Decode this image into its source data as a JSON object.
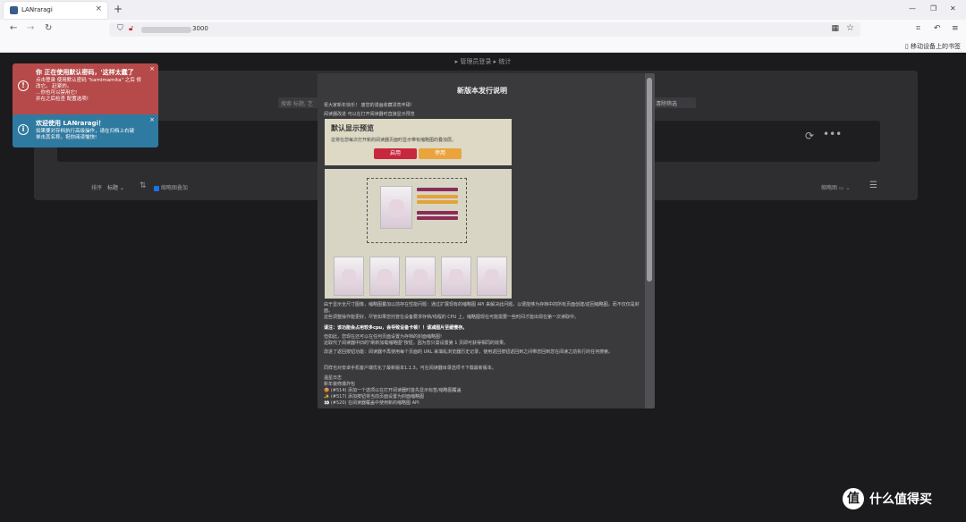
{
  "browser": {
    "tab_title": "LANraragi",
    "new_tab": "+",
    "url_port": "3000",
    "mobile_bookmarks": "移动设备上的书签"
  },
  "page": {
    "breadcrumb": "▸ 管理员登录 ▸ 统计",
    "search_placeholder": "搜索 标题, 艺",
    "clear_filter": "清除筛选",
    "sort_label": "排序",
    "sort_value": "标题",
    "thumb_overlay_label": "缩略图叠加",
    "view_label": "缩略图"
  },
  "toast_warning": {
    "title": "你 正在使用默认密码，'这样太蠢了",
    "body_lines": [
      "点击登录 使用默认密码 \"kamimamita\" 之后 修",
      "改它。 赶紧的。",
      "…你也可以禁用它!",
      "并在之后检查 配置选项!"
    ]
  },
  "toast_info": {
    "title": "欢迎使用 LANraragi！",
    "body_lines": [
      "如果要对存档执行高级操作，请在归档上右键",
      "单击其名称。祝你阅读愉快!"
    ]
  },
  "modal": {
    "title": "新版本发行说明",
    "intro": "祝大家新年快乐！ 废您的漫画收藏漂亮丰硕!",
    "preview_note": "阅读器改进 可以在打开阅读器时直接显示预览",
    "preview_box": {
      "title": "默认显示预览",
      "subtitle": "这将在您每次打开新的阅读器页面时显示带有缩略图的叠加层。",
      "enable": "启用",
      "disable": "停用"
    },
    "para1": "由于显示全尺寸图像，缩略图叠加以前存在性能问题：通过扩展现有的缩略图 API 来解决此问题，以便能够为存档中的所有页面创建/返回缩略图，而不仅仅是封面。",
    "para2": "这些调整操作能更好，尽管如果您托管在设备要求存档/线程的 CPU 上，缩略图现在可能需要一些时间才能出现在第一次读取中。",
    "warning": "请注：该功能会占用较多cpu，会导致设备卡顿！！请减图片至缓慢存。",
    "para3": "但如此，您现在还可以在任何页面设置为存档的封面缩略图!",
    "para4": "这取代了阅读器中旧的\"刷新加载缩略图\"按钮，因为您只需设置第 1 页即可获得相同的效果。",
    "para5": "改进了返回按钮功能：阅读器不再使用每个页面的 URL 来填乱浏览器历史记录，使用返回按钮返回到之间带您回到您在阅读之前执行的任何搜索。",
    "para6": "同样也对安卓手机客户端优化了最新版本1.1.3。可在阅读器目录选项卡下载最新版本。",
    "changelog_title": "温星日志",
    "changelog_sub": "新年装修爆炸包",
    "changelog": [
      "🍪 (#514) 添加一个选项以在打开阅读器时首先显示标签/缩略图覆盖",
      "✨ (#517) 添加按钮将当前页面设置为封面缩略图",
      "👀 (#520) 在阅读器覆盖中使用新的缩略图 API"
    ]
  },
  "watermark": {
    "logo": "值",
    "text": "什么值得买"
  },
  "colors": {
    "page_bg": "#1b1b1d",
    "warning_toast": "#b64a4a",
    "info_toast": "#2f7aa0",
    "modal_bg": "#3a3a3d",
    "enable_btn": "#c8283f",
    "disable_btn": "#e9a43d"
  }
}
